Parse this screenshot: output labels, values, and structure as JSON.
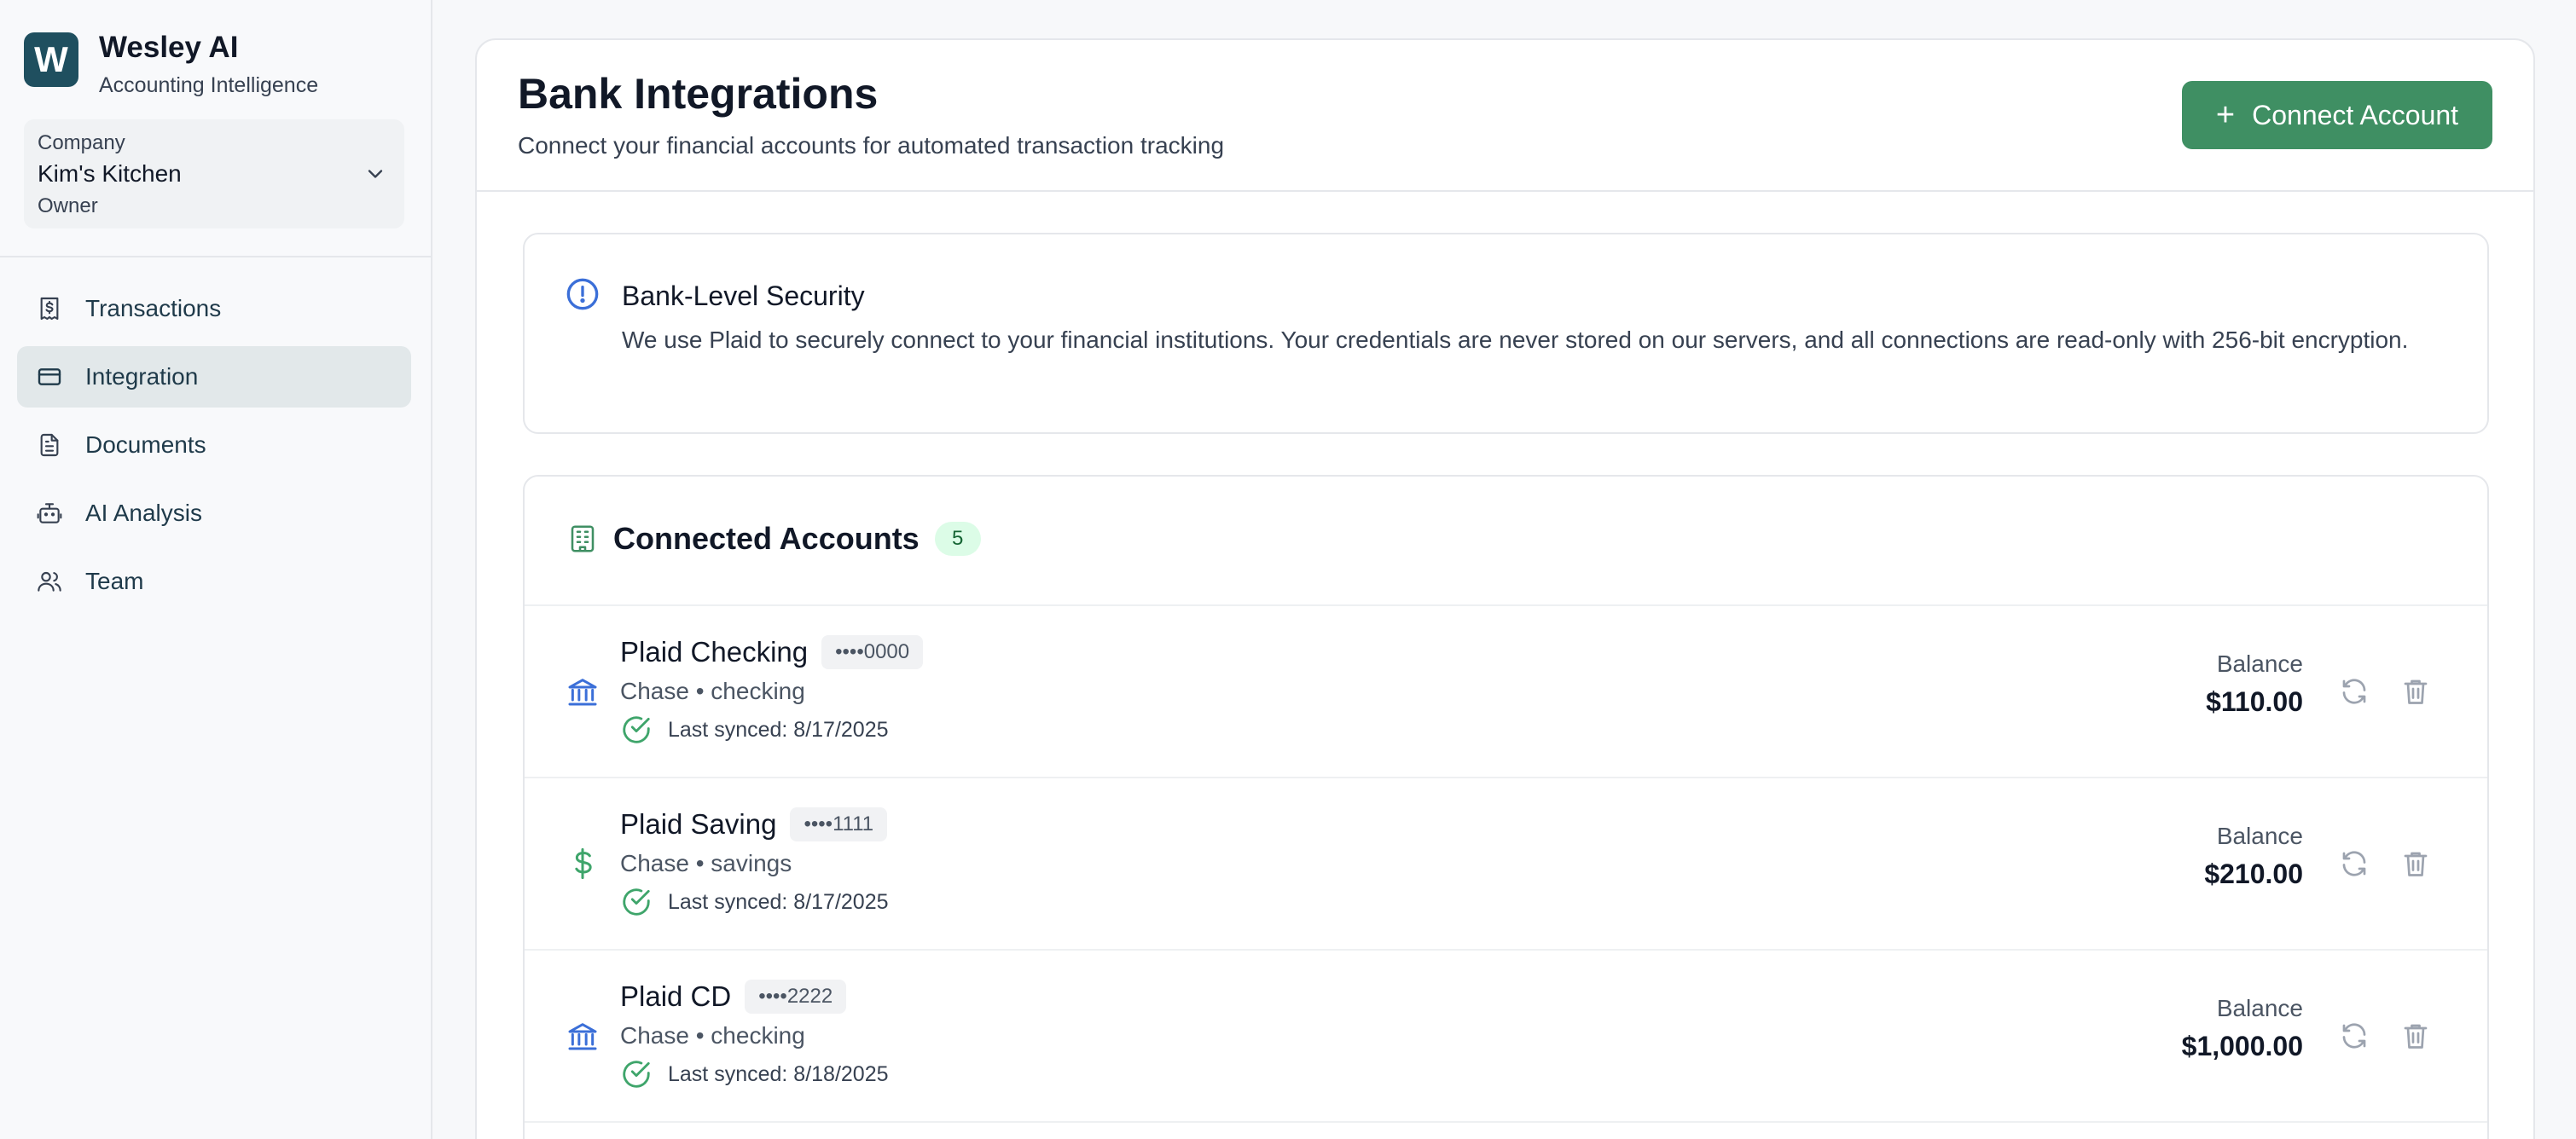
{
  "brand": {
    "logo_letter": "W",
    "name": "Wesley AI",
    "subtitle": "Accounting Intelligence"
  },
  "company": {
    "label": "Company",
    "name": "Kim's Kitchen",
    "role": "Owner"
  },
  "nav": [
    {
      "label": "Transactions",
      "icon": "receipt-dollar-icon"
    },
    {
      "label": "Integration",
      "icon": "credit-card-icon",
      "active": true
    },
    {
      "label": "Documents",
      "icon": "document-icon"
    },
    {
      "label": "AI Analysis",
      "icon": "robot-icon"
    },
    {
      "label": "Team",
      "icon": "users-icon"
    }
  ],
  "page": {
    "title": "Bank Integrations",
    "subtitle": "Connect your financial accounts for automated transaction tracking",
    "connect_button": "Connect Account"
  },
  "security": {
    "title": "Bank-Level Security",
    "text": "We use Plaid to securely connect to your financial institutions. Your credentials are never stored on our servers, and all connections are read-only with 256-bit encryption."
  },
  "accounts": {
    "title": "Connected Accounts",
    "count": "5",
    "items": [
      {
        "name": "Plaid Checking",
        "mask": "••••0000",
        "meta": "Chase • checking",
        "sync": "Last synced: 8/17/2025",
        "balance_label": "Balance",
        "balance": "$110.00",
        "icon": "bank-icon"
      },
      {
        "name": "Plaid Saving",
        "mask": "••••1111",
        "meta": "Chase • savings",
        "sync": "Last synced: 8/17/2025",
        "balance_label": "Balance",
        "balance": "$210.00",
        "icon": "dollar-icon"
      },
      {
        "name": "Plaid CD",
        "mask": "••••2222",
        "meta": "Chase • checking",
        "sync": "Last synced: 8/18/2025",
        "balance_label": "Balance",
        "balance": "$1,000.00",
        "icon": "bank-icon"
      }
    ]
  },
  "colors": {
    "brand_dark": "#1f4f5f",
    "accent_green": "#3f8f63",
    "icon_blue": "#3b6fd8",
    "check_green": "#3fa56b"
  }
}
